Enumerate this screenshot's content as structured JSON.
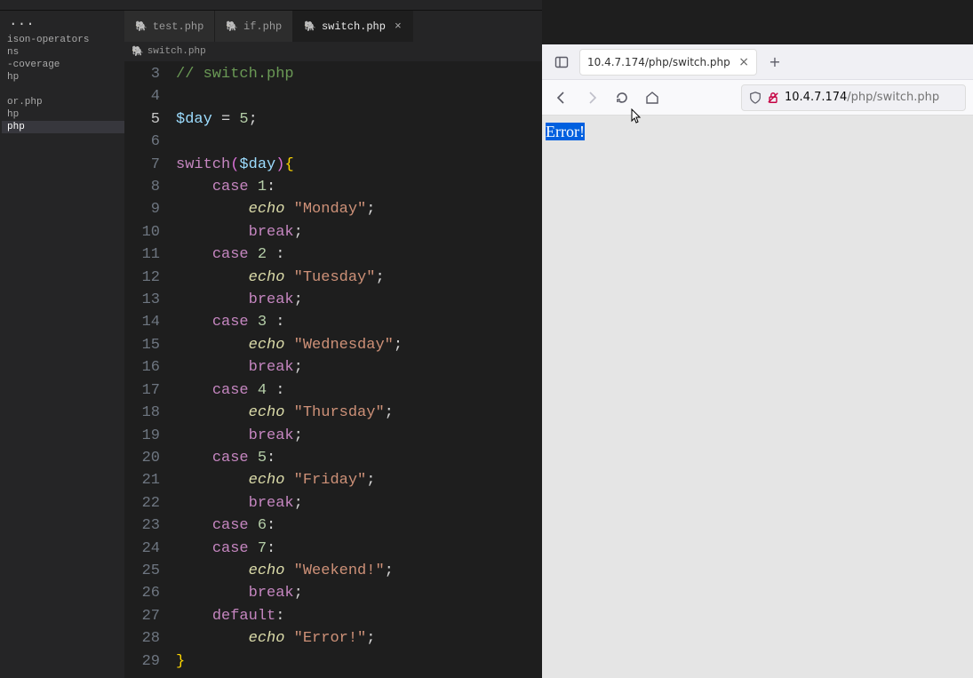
{
  "editor": {
    "sidebar": {
      "ellipsis": "···",
      "items": [
        "ison-operators",
        "ns",
        "-coverage",
        "hp",
        "",
        "or.php",
        "hp",
        "php",
        ""
      ],
      "selected_index": 7
    },
    "tabs": [
      {
        "label": "test.php",
        "active": false
      },
      {
        "label": "if.php",
        "active": false
      },
      {
        "label": "switch.php",
        "active": true
      }
    ],
    "breadcrumb": {
      "label": "switch.php"
    },
    "gutter_start": 3,
    "gutter_end": 29,
    "current_line": 5,
    "code": {
      "l3_comment": "// switch.php",
      "l5_var": "$day",
      "l5_eq": " = ",
      "l5_num": "5",
      "l5_semi": ";",
      "l7_kw": "switch",
      "l7_lp": "(",
      "l7_var": "$day",
      "l7_rp": ")",
      "l7_lb": "{",
      "l8_case": "case ",
      "l8_num": "1",
      "l8_colon": ":",
      "l9_echo": "echo ",
      "l9_str": "\"Monday\"",
      "l9_semi": ";",
      "l10_brk": "break",
      "l10_semi": ";",
      "l11_case": "case ",
      "l11_num": "2",
      "l11_sp": " ",
      "l11_colon": ":",
      "l12_echo": "echo ",
      "l12_str": "\"Tuesday\"",
      "l12_semi": ";",
      "l13_brk": "break",
      "l13_semi": ";",
      "l14_case": "case ",
      "l14_num": "3",
      "l14_sp": " ",
      "l14_colon": ":",
      "l15_echo": "echo ",
      "l15_str": "\"Wednesday\"",
      "l15_semi": ";",
      "l16_brk": "break",
      "l16_semi": ";",
      "l17_case": "case ",
      "l17_num": "4",
      "l17_sp": " ",
      "l17_colon": ":",
      "l18_echo": "echo ",
      "l18_str": "\"Thursday\"",
      "l18_semi": ";",
      "l19_brk": "break",
      "l19_semi": ";",
      "l20_case": "case ",
      "l20_num": "5",
      "l20_colon": ":",
      "l21_echo": "echo ",
      "l21_str": "\"Friday\"",
      "l21_semi": ";",
      "l22_brk": "break",
      "l22_semi": ";",
      "l23_case": "case ",
      "l23_num": "6",
      "l23_colon": ":",
      "l24_case": "case ",
      "l24_num": "7",
      "l24_colon": ":",
      "l25_echo": "echo ",
      "l25_str": "\"Weekend!\"",
      "l25_semi": ";",
      "l26_brk": "break",
      "l26_semi": ";",
      "l27_def": "default",
      "l27_colon": ":",
      "l28_echo": "echo ",
      "l28_str": "\"Error!\"",
      "l28_semi": ";",
      "l29_rb": "}"
    }
  },
  "browser": {
    "tab_title": "10.4.7.174/php/switch.php",
    "url_host": "10.4.7.174",
    "url_path": "/php/switch.php",
    "page_text": "Error!"
  }
}
